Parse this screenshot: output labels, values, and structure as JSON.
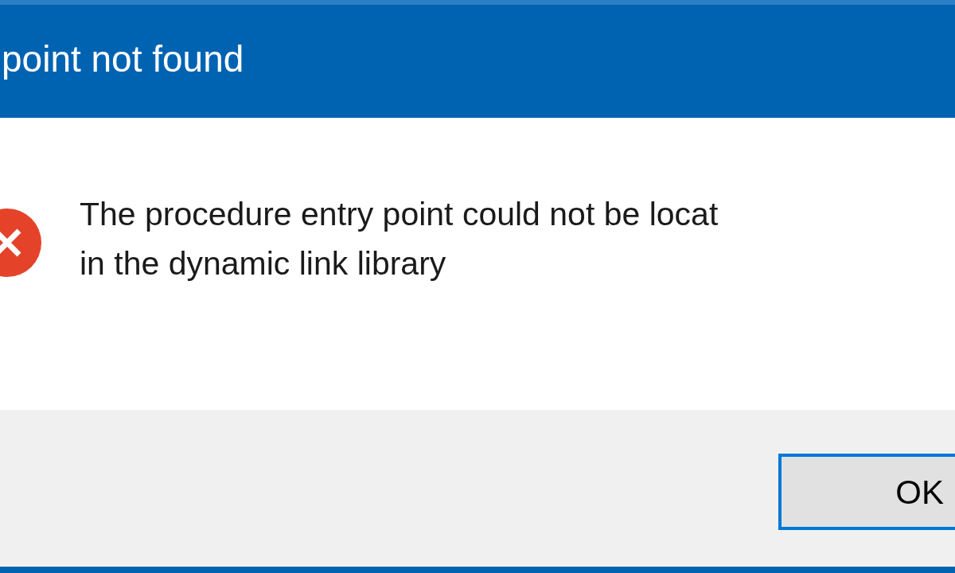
{
  "window": {
    "title": "point not found"
  },
  "message": {
    "lines": [
      "The procedure entry point could not be locat",
      "in the dynamic link library"
    ]
  },
  "buttons": [
    {
      "label": "OK",
      "selected": true
    }
  ]
}
